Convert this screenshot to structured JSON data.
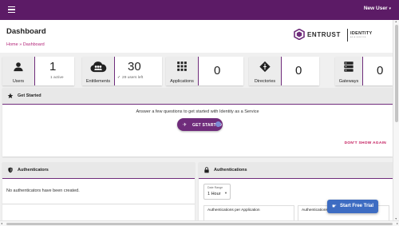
{
  "topbar": {
    "user_label": "New User",
    "caret": "▾",
    "color": "#5c1b66"
  },
  "header": {
    "title": "Dashboard",
    "breadcrumb": "Home » Dashboard"
  },
  "logo": {
    "word": "ENTRUST",
    "identity": "IDENTITY",
    "identity_sub": "AS A SERVICE"
  },
  "stats": [
    {
      "label": "Users",
      "value": "1",
      "sub": "1 active",
      "icon": "user-icon"
    },
    {
      "label": "Entitlements",
      "value": "30",
      "sub": "29 users left",
      "icon": "cloud-users-icon"
    },
    {
      "label": "Applications",
      "value": "0",
      "icon": "apps-grid-icon"
    },
    {
      "label": "Directories",
      "value": "0",
      "icon": "directory-icon"
    },
    {
      "label": "Gateways",
      "value": "0",
      "icon": "gateway-server-icon"
    }
  ],
  "getting_started": {
    "title": "Get Started",
    "prompt": "Answer a few questions to get started with Identity as a Service",
    "button": "GET STARTED",
    "dismiss": "DON'T SHOW AGAIN"
  },
  "authenticators": {
    "title": "Authenticators",
    "empty": "No authenticators have been created."
  },
  "authentications": {
    "title": "Authentications",
    "date_range_label": "Date Range",
    "date_range_value": "1 Hour",
    "cards": [
      "Authentications per Application",
      "Authentications per Authenticator"
    ]
  },
  "free_trial": {
    "label": "Start Free Trial",
    "color": "#3d6cc2"
  },
  "accent": "#6f2c7b",
  "link_color": "#b3267a"
}
